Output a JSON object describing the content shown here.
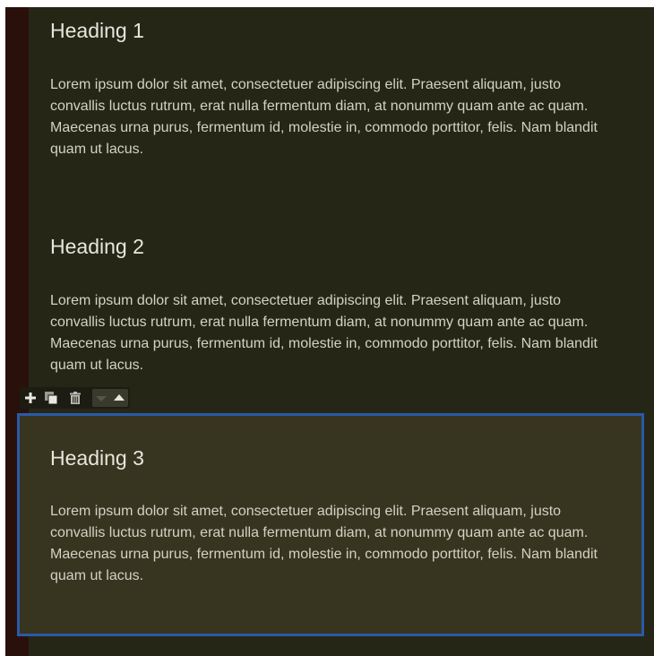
{
  "sections": [
    {
      "heading": "Heading 1",
      "body": "Lorem ipsum dolor sit amet, consectetuer adipiscing elit. Praesent aliquam, justo convallis luctus rutrum, erat nulla fermentum diam, at nonummy quam ante ac quam. Maecenas urna purus, fermentum id, molestie in, commodo porttitor, felis. Nam blandit quam ut lacus."
    },
    {
      "heading": "Heading 2",
      "body": "Lorem ipsum dolor sit amet, consectetuer adipiscing elit. Praesent aliquam, justo convallis luctus rutrum, erat nulla fermentum diam, at nonummy quam ante ac quam. Maecenas urna purus, fermentum id, molestie in, commodo porttitor, felis. Nam blandit quam ut lacus."
    },
    {
      "heading": "Heading 3",
      "body": "Lorem ipsum dolor sit amet, consectetuer adipiscing elit. Praesent aliquam, justo convallis luctus rutrum, erat nulla fermentum diam, at nonummy quam ante ac quam. Maecenas urna purus, fermentum id, molestie in, commodo porttitor, felis. Nam blandit quam ut lacus.",
      "selected": true
    }
  ],
  "toolbar": {
    "icons": [
      "plus-icon",
      "duplicate-icon",
      "trash-icon",
      "move-down-icon",
      "move-up-icon"
    ]
  },
  "colors": {
    "background": "#262617",
    "left_strip": "#2a100a",
    "selected_background": "#37351f",
    "selection_border": "#2a5aa8",
    "text": "#d2d2c6"
  }
}
